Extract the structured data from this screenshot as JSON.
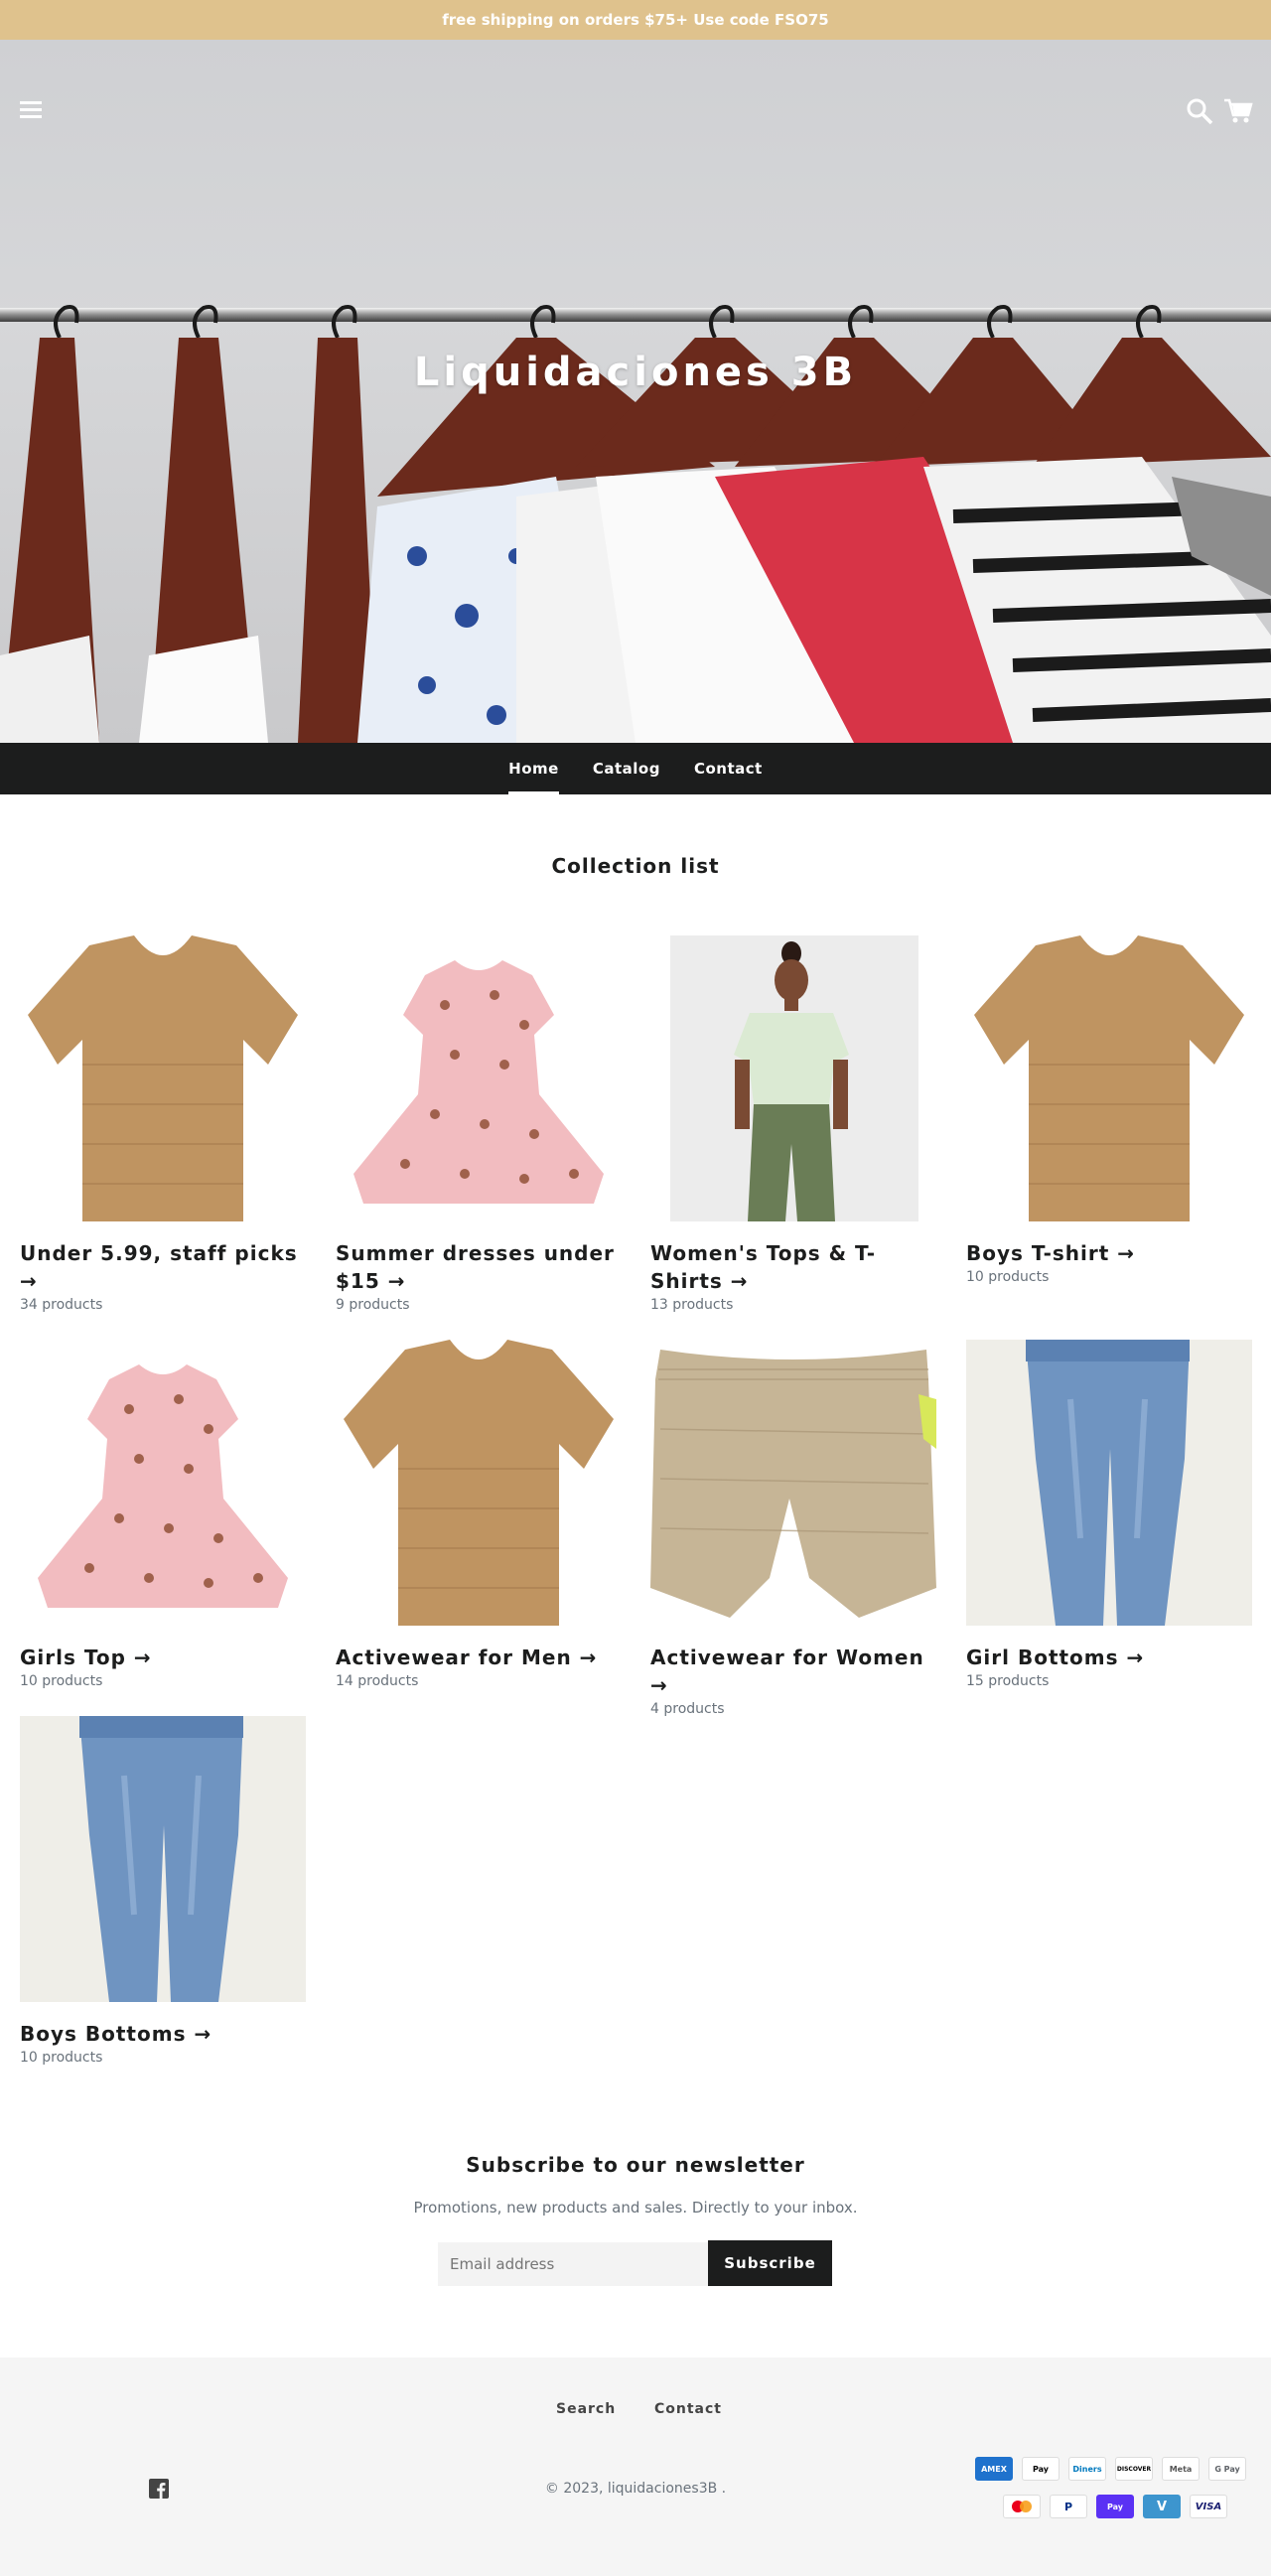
{
  "announcement": {
    "text": "free shipping on orders $75+ Use code FSO75"
  },
  "header": {
    "menu_icon": "hamburger-menu-icon",
    "search_icon": "search-icon",
    "cart_icon": "cart-icon",
    "store_title": "Liquidaciones 3B"
  },
  "nav": {
    "items": [
      {
        "label": "Home",
        "active": true
      },
      {
        "label": "Catalog",
        "active": false
      },
      {
        "label": "Contact",
        "active": false
      }
    ]
  },
  "collection": {
    "title": "Collection list",
    "items": [
      {
        "title": "Under 5.99, staff picks →",
        "count": "34 products",
        "image": "tan-tshirt"
      },
      {
        "title": "Summer dresses under $15 →",
        "count": "9 products",
        "image": "pink-dress"
      },
      {
        "title": "Women's Tops & T-Shirts →",
        "count": "13 products",
        "image": "woman-model"
      },
      {
        "title": "Boys T-shirt →",
        "count": "10 products",
        "image": "tan-tshirt"
      },
      {
        "title": "Girls Top →",
        "count": "10 products",
        "image": "pink-dress"
      },
      {
        "title": "Activewear for Men →",
        "count": "14 products",
        "image": "tan-tshirt"
      },
      {
        "title": "Activewear for Women →",
        "count": "4 products",
        "image": "khaki-shorts"
      },
      {
        "title": "Girl Bottoms →",
        "count": "15 products",
        "image": "blue-jeans"
      },
      {
        "title": "Boys Bottoms →",
        "count": "10 products",
        "image": "blue-jeans"
      }
    ]
  },
  "newsletter": {
    "title": "Subscribe to our newsletter",
    "subtitle": "Promotions, new products and sales. Directly to your inbox.",
    "placeholder": "Email address",
    "button": "Subscribe"
  },
  "footer": {
    "links": [
      "Search",
      "Contact"
    ],
    "copyright": "© 2023, liquidaciones3B .",
    "social_icon": "facebook-icon",
    "payments": [
      "AMEX",
      "Pay",
      "Diners",
      "DISCOVER",
      "Meta",
      "G Pay",
      "Mastercard",
      "P",
      "Pay",
      "V",
      "VISA"
    ]
  },
  "colors": {
    "announcement_bg": "#dfc28d",
    "nav_bg": "#1c1d1d",
    "footer_bg": "#f5f5f5"
  }
}
